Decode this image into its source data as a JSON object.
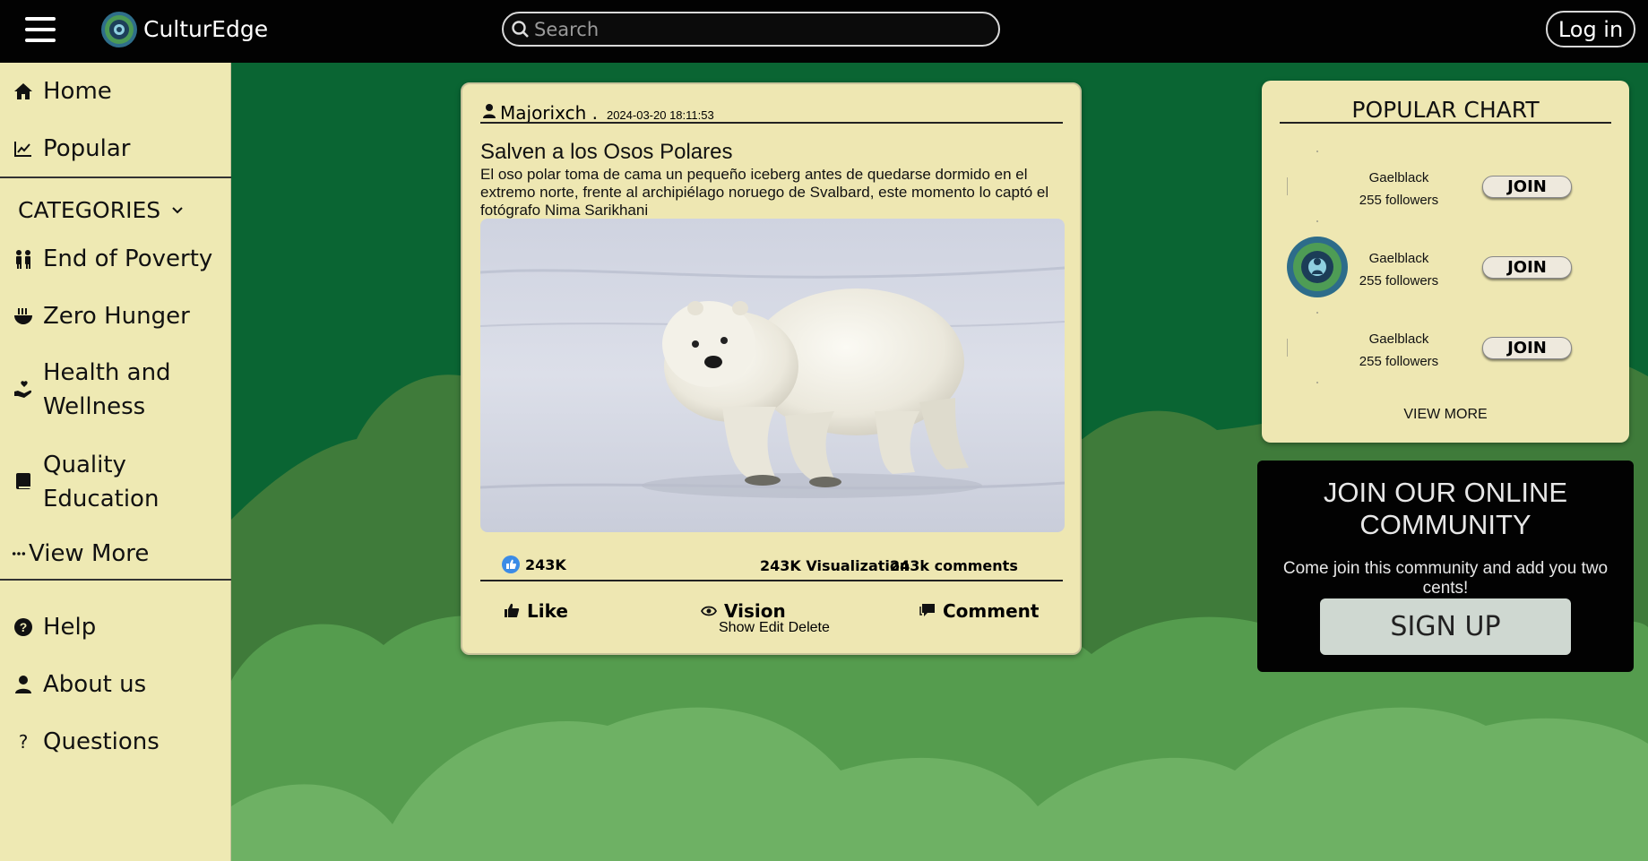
{
  "header": {
    "menu_icon": "hamburger-icon",
    "logo_icon": "culturedge-logo",
    "brand": "CulturEdge",
    "search_placeholder": "Search",
    "login_label": "Log in"
  },
  "sidebar": {
    "top_items": [
      {
        "label": "Home",
        "icon": "home-icon"
      },
      {
        "label": "Popular",
        "icon": "chart-icon"
      }
    ],
    "categories_label": "CATEGORIES",
    "categories": [
      {
        "label": "End of Poverty",
        "icon": "people-icon"
      },
      {
        "label": "Zero Hunger",
        "icon": "bowl-icon"
      },
      {
        "label": "Health and Wellness",
        "icon": "hand-heart-icon"
      },
      {
        "label": "Quality Education",
        "icon": "book-icon"
      }
    ],
    "view_more": "View More",
    "bottom_items": [
      {
        "label": "Help",
        "icon": "help-icon"
      },
      {
        "label": "About us",
        "icon": "user-icon"
      },
      {
        "label": "Questions",
        "icon": "question-icon"
      }
    ]
  },
  "post": {
    "author": "Majorixch .",
    "date": "2024-03-20 18:11:53",
    "title": "Salven a los Osos Polares",
    "description": "El oso polar toma de cama un pequeño iceberg antes de quedarse dormido en el extremo norte, frente al archipiélago noruego de Svalbard, este momento lo captó el fotógrafo Nima Sarikhani",
    "likes": "243K",
    "visualizations": "243K Visualization",
    "comments": "243k comments",
    "actions": {
      "like": "Like",
      "vision": "Vision",
      "comment": "Comment"
    },
    "show": "Show",
    "edit": "Edit",
    "delete": "Delete"
  },
  "popular": {
    "title": "POPULAR CHART",
    "items": [
      {
        "name": "Gaelblack",
        "followers": "255 followers",
        "join": "JOIN"
      },
      {
        "name": "Gaelblack",
        "followers": "255 followers",
        "join": "JOIN"
      },
      {
        "name": "Gaelblack",
        "followers": "255 followers",
        "join": "JOIN"
      }
    ],
    "view_more": "VIEW MORE"
  },
  "community": {
    "title": "JOIN OUR ONLINE COMMUNITY",
    "subtitle": "Come join this community and add you two cents!",
    "signup": "SIGN UP"
  },
  "colors": {
    "topbar": "#020202",
    "background": "#0a6533",
    "hill_dark": "#3f7b3a",
    "hill_mid": "#559c4e",
    "hill_light": "#6eb164",
    "panel": "#eee7b2"
  }
}
